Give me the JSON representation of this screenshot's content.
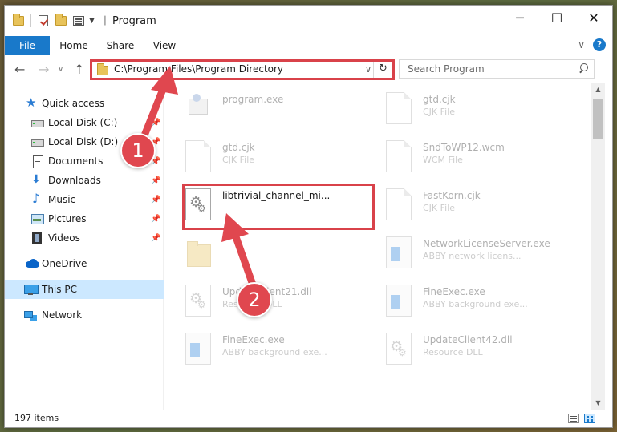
{
  "window": {
    "title": "Program",
    "controls": {
      "minimize": "─",
      "maximize": "☐",
      "close": "✕"
    }
  },
  "ribbon": {
    "tabs": [
      "File",
      "Home",
      "Share",
      "View"
    ],
    "collapse_glyph": "∨",
    "help_glyph": "?"
  },
  "nav": {
    "back_glyph": "←",
    "forward_glyph": "→",
    "recent_glyph": "∨",
    "up_glyph": "↑",
    "address": "C:\\Program Files\\Program Directory",
    "address_dropdown_glyph": "∨",
    "refresh_glyph": "↻",
    "search_placeholder": "Search Program"
  },
  "sidebar": {
    "items": [
      {
        "label": "Quick access",
        "icon": "star-icon",
        "pinned": false
      },
      {
        "label": "Local Disk (C:)",
        "icon": "drive-icon",
        "pinned": true
      },
      {
        "label": "Local Disk (D:)",
        "icon": "drive-icon",
        "pinned": true
      },
      {
        "label": "Documents",
        "icon": "documents-icon",
        "pinned": true
      },
      {
        "label": "Downloads",
        "icon": "downloads-icon",
        "pinned": true
      },
      {
        "label": "Music",
        "icon": "music-icon",
        "pinned": true
      },
      {
        "label": "Pictures",
        "icon": "pictures-icon",
        "pinned": true
      },
      {
        "label": "Videos",
        "icon": "videos-icon",
        "pinned": true
      },
      {
        "label": "OneDrive",
        "icon": "onedrive-icon",
        "pinned": false
      },
      {
        "label": "This PC",
        "icon": "this-pc-icon",
        "pinned": false,
        "selected": true
      },
      {
        "label": "Network",
        "icon": "network-icon",
        "pinned": false
      }
    ],
    "pin_glyph": "📌"
  },
  "files": [
    {
      "name": "program.exe",
      "type": "",
      "icon": "exe-icon"
    },
    {
      "name": "gtd.cjk",
      "type": "CJK File",
      "icon": "document-icon"
    },
    {
      "name": "gtd.cjk",
      "type": "CJK File",
      "icon": "document-icon"
    },
    {
      "name": "SndToWP12.wcm",
      "type": "WCM File",
      "icon": "document-icon"
    },
    {
      "name": "libtrivial_channel_mi...",
      "type": "",
      "icon": "dll-gear-icon",
      "highlighted": true
    },
    {
      "name": "FastKorn.cjk",
      "type": "CJK File",
      "icon": "document-icon"
    },
    {
      "name": "",
      "type": "",
      "icon": "folder-icon"
    },
    {
      "name": "NetworkLicenseServer.exe",
      "type": "ABBY network licens...",
      "icon": "app-icon"
    },
    {
      "name": "UpdateClient21.dll",
      "type": "Resource DLL",
      "icon": "dll-gear-icon"
    },
    {
      "name": "FineExec.exe",
      "type": "ABBY background exe...",
      "icon": "app-icon"
    },
    {
      "name": "FineExec.exe",
      "type": "ABBY background exe...",
      "icon": "app-icon"
    },
    {
      "name": "UpdateClient42.dll",
      "type": "Resource DLL",
      "icon": "dll-gear-icon"
    }
  ],
  "status": {
    "item_count": "197 items"
  },
  "annotations": {
    "step1": "1",
    "step2": "2"
  },
  "colors": {
    "accent": "#1979ca",
    "highlight": "#d9424a",
    "badge": "#e0474f",
    "selection": "#cce8ff"
  }
}
